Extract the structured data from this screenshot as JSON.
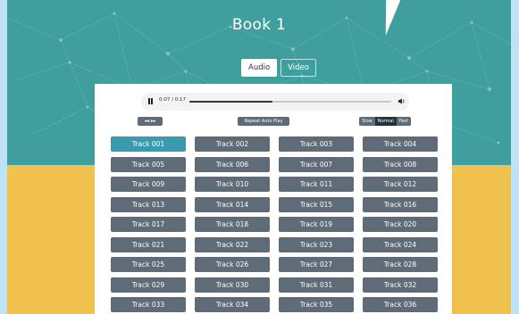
{
  "page": {
    "title": "Book 1"
  },
  "tabs": [
    {
      "label": "Audio",
      "active": true
    },
    {
      "label": "Video",
      "active": false
    }
  ],
  "player": {
    "state": "playing",
    "time_display": "0:07 / 0:17",
    "progress_fraction": 0.41
  },
  "controls": {
    "seek_label": "◂◂ ▸▸",
    "mid_label": "Repeat  Auto Play",
    "speeds": [
      {
        "label": "Slow",
        "active": false
      },
      {
        "label": "Normal",
        "active": true
      },
      {
        "label": "Fast",
        "active": false
      }
    ]
  },
  "tracks": {
    "selected_index": 0,
    "items": [
      "Track 001",
      "Track 002",
      "Track 003",
      "Track 004",
      "Track 005",
      "Track 006",
      "Track 007",
      "Track 008",
      "Track 009",
      "Track 010",
      "Track 011",
      "Track 012",
      "Track 013",
      "Track 014",
      "Track 015",
      "Track 016",
      "Track 017",
      "Track 018",
      "Track 019",
      "Track 020",
      "Track 021",
      "Track 022",
      "Track 023",
      "Track 024",
      "Track 025",
      "Track 026",
      "Track 027",
      "Track 028",
      "Track 029",
      "Track 030",
      "Track 031",
      "Track 032",
      "Track 033",
      "Track 034",
      "Track 035",
      "Track 036"
    ]
  },
  "colors": {
    "hero_teal": "#3f9e9e",
    "lower_yellow": "#efc24f",
    "outer_blue": "#bfe3f6",
    "track_gray": "#5f6b76",
    "track_selected": "#3a9ab0"
  }
}
